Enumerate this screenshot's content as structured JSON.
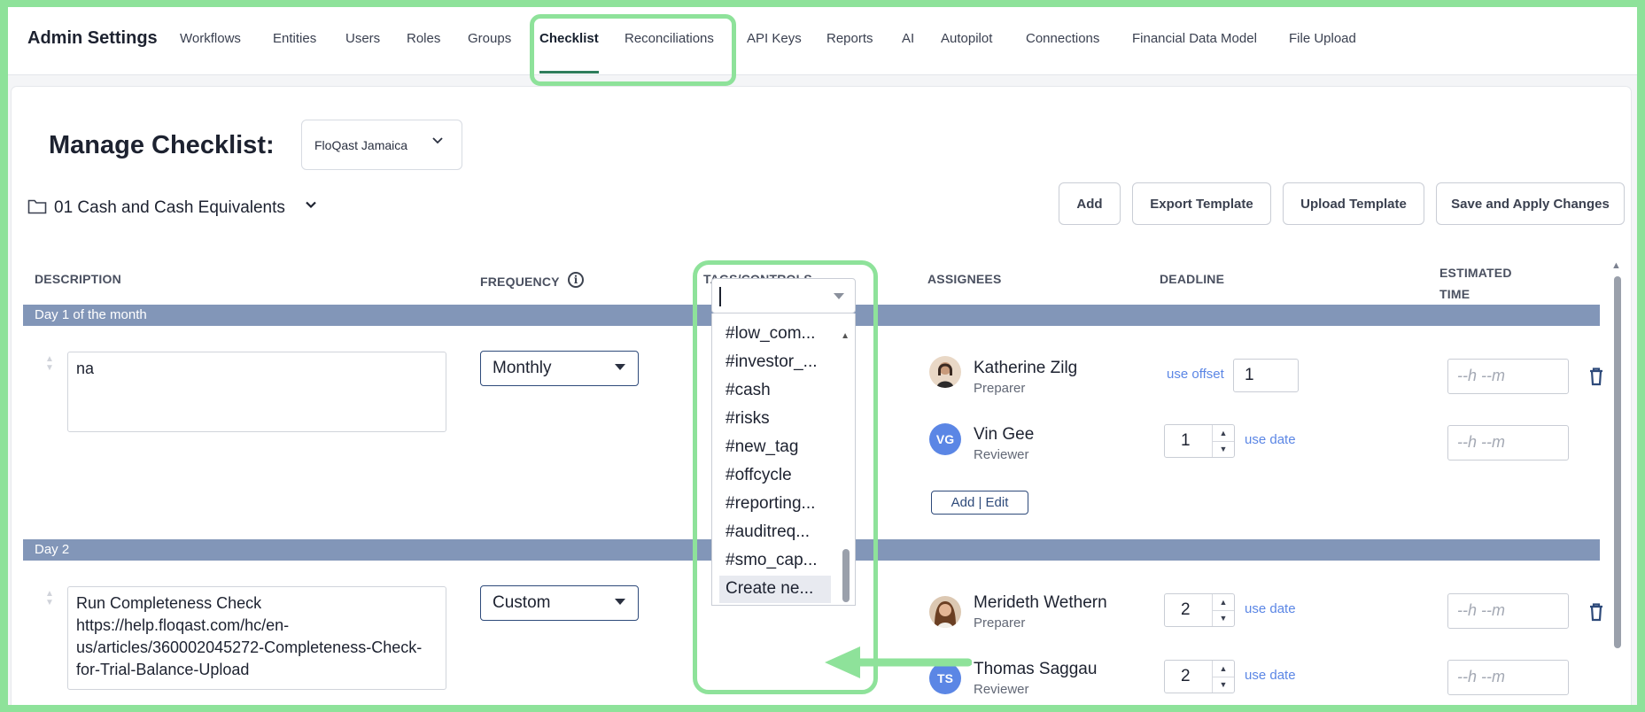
{
  "header": {
    "brand": "Admin Settings",
    "nav": [
      "Workflows",
      "Entities",
      "Users",
      "Roles",
      "Groups",
      "Checklist",
      "Reconciliations",
      "API Keys",
      "Reports",
      "AI",
      "Autopilot",
      "Connections",
      "Financial Data Model",
      "File Upload"
    ],
    "active": "Checklist"
  },
  "page": {
    "title": "Manage Checklist:",
    "entity": "FloQast Jamaica",
    "folder": "01 Cash and Cash Equivalents"
  },
  "toolbar": {
    "add": "Add",
    "export": "Export Template",
    "upload": "Upload Template",
    "save": "Save and Apply Changes"
  },
  "columns": {
    "description": "DESCRIPTION",
    "frequency": "FREQUENCY",
    "tags": "TAGS/CONTROLS",
    "assignees": "ASSIGNEES",
    "deadline": "DEADLINE",
    "estimated_time": "ESTIMATED\nTIME"
  },
  "groups": [
    {
      "label": "Day 1 of the month",
      "description": "na",
      "frequency": "Monthly",
      "preparer": {
        "name": "Katherine Zilg",
        "role": "Preparer",
        "deadline_link": "use offset",
        "deadline": "1",
        "time": "--h --m"
      },
      "reviewer": {
        "name": "Vin Gee",
        "initials": "VG",
        "role": "Reviewer",
        "deadline_link": "use date",
        "deadline": "1",
        "time": "--h --m"
      },
      "add_edit": "Add | Edit"
    },
    {
      "label": "Day 2",
      "description": "Run Completeness Check https://help.floqast.com/hc/en-us/articles/360002045272-Completeness-Check-for-Trial-Balance-Upload",
      "frequency": "Custom",
      "preparer": {
        "name": "Merideth Wethern",
        "role": "Preparer",
        "deadline_link": "use date",
        "deadline": "2",
        "time": "--h --m"
      },
      "reviewer": {
        "name": "Thomas Saggau",
        "initials": "TS",
        "role": "Reviewer",
        "deadline_link": "use date",
        "deadline": "2",
        "time": "--h --m"
      }
    }
  ],
  "tags_dropdown": {
    "options": [
      "#low_com...",
      "#investor_...",
      "#cash",
      "#risks",
      "#new_tag",
      "#offcycle",
      "#reporting...",
      "#auditreq...",
      "#smo_cap..."
    ],
    "create": "Create ne..."
  },
  "colors": {
    "highlight": "#8ee29a",
    "band": "#8296b8",
    "accent": "#2e4a7a",
    "link": "#5b86e5"
  }
}
